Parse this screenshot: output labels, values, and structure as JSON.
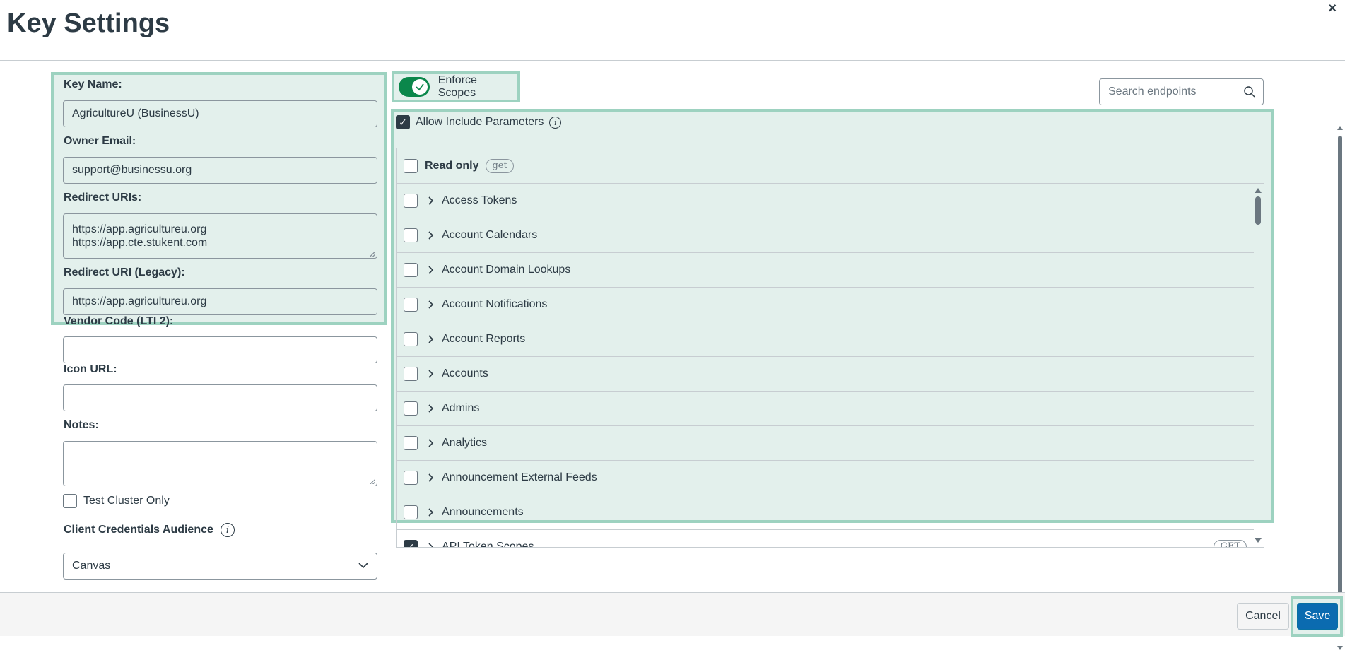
{
  "header": {
    "title": "Key Settings",
    "close": "×"
  },
  "form": {
    "key_name_label": "Key Name:",
    "key_name_value": "AgricultureU (BusinessU)",
    "owner_email_label": "Owner Email:",
    "owner_email_value": "support@businessu.org",
    "redirect_uris_label": "Redirect URIs:",
    "redirect_uris_line1": "https://app.agricultureu.org",
    "redirect_uris_line2": "https://app.cte.stukent.com",
    "redirect_uri_legacy_label": "Redirect URI (Legacy):",
    "redirect_uri_legacy_value": "https://app.agricultureu.org",
    "vendor_code_label": "Vendor Code (LTI 2):",
    "vendor_code_value": "",
    "icon_url_label": "Icon URL:",
    "icon_url_value": "",
    "notes_label": "Notes:",
    "notes_value": "",
    "test_cluster_label": "Test Cluster Only",
    "test_cluster_checked": false,
    "client_credentials_label": "Client Credentials Audience",
    "client_credentials_value": "Canvas"
  },
  "scopes": {
    "enforce_label": "Enforce Scopes",
    "enforce_on": true,
    "search_placeholder": "Search endpoints",
    "allow_include_label": "Allow Include Parameters",
    "allow_include_checked": true,
    "read_only_label": "Read only",
    "read_only_badge": "get",
    "items": [
      {
        "label": "Access Tokens",
        "checked": false
      },
      {
        "label": "Account Calendars",
        "checked": false
      },
      {
        "label": "Account Domain Lookups",
        "checked": false
      },
      {
        "label": "Account Notifications",
        "checked": false
      },
      {
        "label": "Account Reports",
        "checked": false
      },
      {
        "label": "Accounts",
        "checked": false
      },
      {
        "label": "Admins",
        "checked": false
      },
      {
        "label": "Analytics",
        "checked": false
      },
      {
        "label": "Announcement External Feeds",
        "checked": false
      },
      {
        "label": "Announcements",
        "checked": false
      },
      {
        "label": "API Token Scopes",
        "checked": true,
        "badge": "GET"
      }
    ]
  },
  "footer": {
    "cancel_label": "Cancel",
    "save_label": "Save"
  },
  "colors": {
    "accent": "#0b6bb0",
    "toggle": "#0b874b",
    "highlight": "#9dd2c0"
  }
}
